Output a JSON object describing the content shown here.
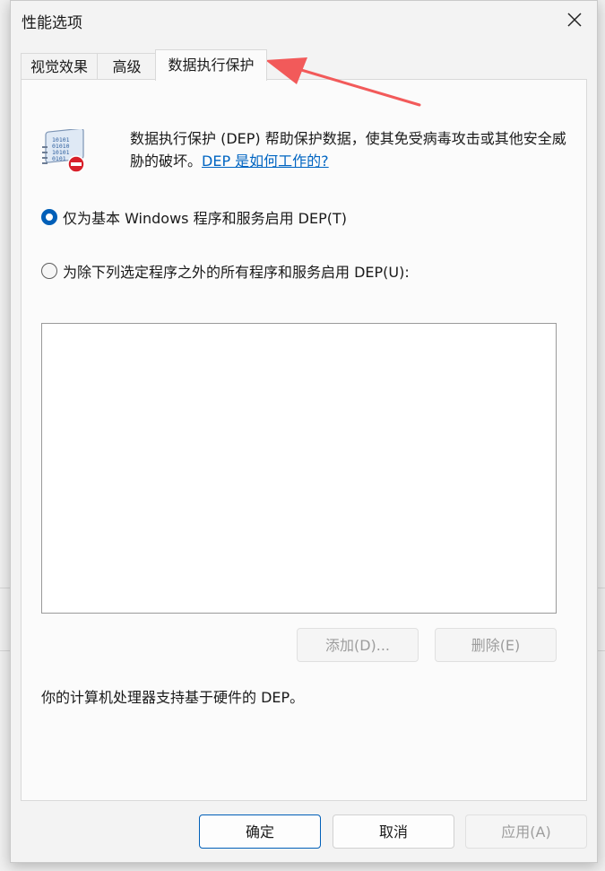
{
  "window": {
    "title": "性能选项"
  },
  "tabs": [
    {
      "label": "视觉效果"
    },
    {
      "label": "高级"
    },
    {
      "label": "数据执行保护"
    }
  ],
  "dep": {
    "description": "数据执行保护 (DEP) 帮助保护数据，使其免受病毒攻击或其他安全威胁的破坏。",
    "link": "DEP 是如何工作的?"
  },
  "options": [
    {
      "label": "仅为基本 Windows 程序和服务启用 DEP(T)",
      "selected": true
    },
    {
      "label": "为除下列选定程序之外的所有程序和服务启用 DEP(U):",
      "selected": false
    }
  ],
  "list_buttons": {
    "add": "添加(D)...",
    "remove": "删除(E)"
  },
  "status": "你的计算机处理器支持基于硬件的 DEP。",
  "footer": {
    "ok": "确定",
    "cancel": "取消",
    "apply": "应用(A)"
  },
  "colors": {
    "accent": "#005fb8",
    "link": "#0065c2",
    "annotation_arrow": "#f25a5a"
  }
}
